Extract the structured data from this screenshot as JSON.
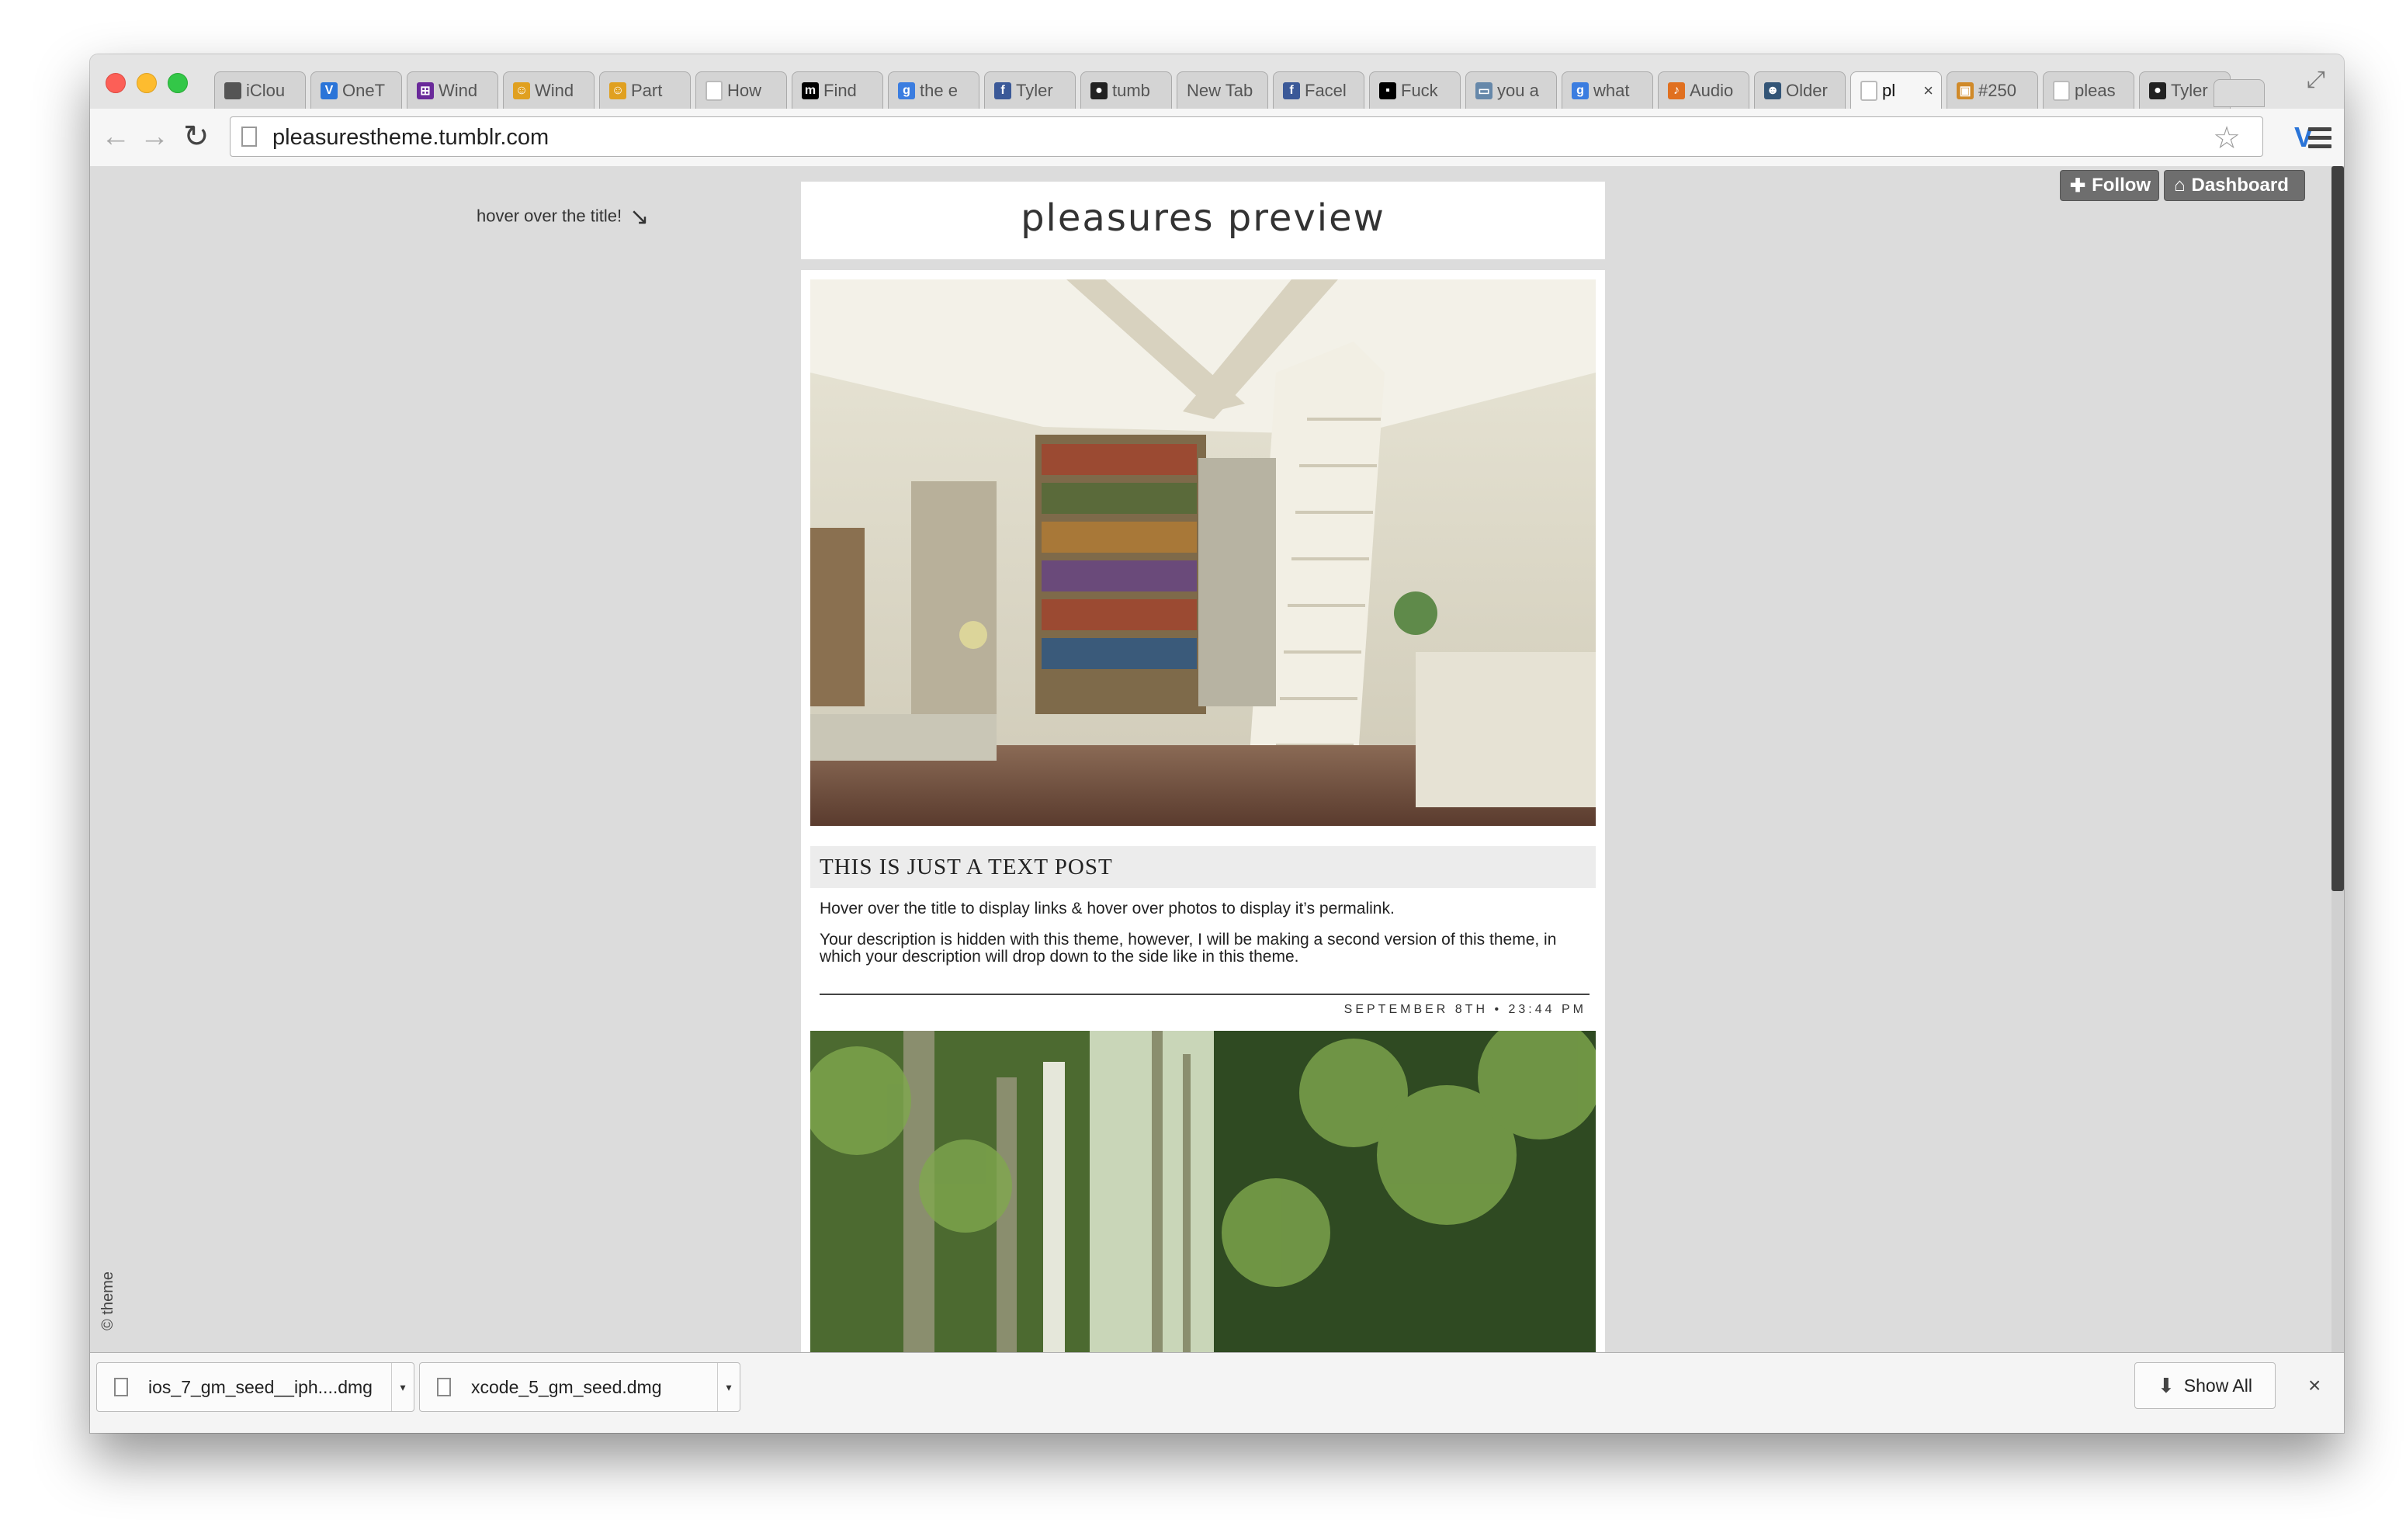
{
  "browser": {
    "tabs": [
      {
        "label": "iClou",
        "icon": "apple-icon",
        "color": "#555555"
      },
      {
        "label": "OneT",
        "icon": "v-icon",
        "color": "#2a74d8"
      },
      {
        "label": "Wind",
        "icon": "windows-icon",
        "color": "#6a2a9a"
      },
      {
        "label": "Wind",
        "icon": "people-icon",
        "color": "#e0a020"
      },
      {
        "label": "Part",
        "icon": "people-icon",
        "color": "#e0a020"
      },
      {
        "label": "How",
        "icon": "page-icon",
        "color": "#bbbbbb"
      },
      {
        "label": "Find",
        "icon": "m-icon",
        "color": "#000000"
      },
      {
        "label": "the e",
        "icon": "google-icon",
        "color": "#3b7de0"
      },
      {
        "label": "Tyler",
        "icon": "facebook-icon",
        "color": "#3b5998"
      },
      {
        "label": "tumb",
        "icon": "github-icon",
        "color": "#222222"
      },
      {
        "label": "New Tab",
        "icon": "none",
        "color": "#f6f6f6"
      },
      {
        "label": "Facel",
        "icon": "facebook-icon",
        "color": "#3b5998"
      },
      {
        "label": "Fuck",
        "icon": "fuck-icon",
        "color": "#000000"
      },
      {
        "label": "you a",
        "icon": "laptop-icon",
        "color": "#6688aa"
      },
      {
        "label": "what",
        "icon": "google-icon",
        "color": "#3b7de0"
      },
      {
        "label": "Audio",
        "icon": "audio-icon",
        "color": "#e07020"
      },
      {
        "label": "Older",
        "icon": "person-icon",
        "color": "#335577"
      },
      {
        "label": "pl",
        "icon": "page-icon",
        "color": "#bbbbbb",
        "active": true
      },
      {
        "label": "#250",
        "icon": "folder-icon",
        "color": "#d08a2a"
      },
      {
        "label": "pleas",
        "icon": "page-icon",
        "color": "#bbbbbb"
      },
      {
        "label": "Tyler",
        "icon": "github-icon",
        "color": "#222222"
      }
    ],
    "url": "pleasurestheme.tumblr.com"
  },
  "page": {
    "hover_hint": "hover over the title!",
    "follow_label": "Follow",
    "dashboard_label": "Dashboard",
    "title": "pleasures preview",
    "post": {
      "title": "THIS IS JUST A TEXT POST",
      "paragraph1": "Hover over the title to display links & hover over photos to display it’s permalink.",
      "paragraph2": "Your description is hidden with this theme, however, I will be making a second version of this theme, in which your description will drop down to the side like in this theme.",
      "date": "SEPTEMBER 8TH • 23:44 PM"
    },
    "copyright": "© theme"
  },
  "downloads": {
    "items": [
      {
        "filename": "ios_7_gm_seed__iph....dmg"
      },
      {
        "filename": "xcode_5_gm_seed.dmg"
      }
    ],
    "show_all_label": "Show All"
  }
}
